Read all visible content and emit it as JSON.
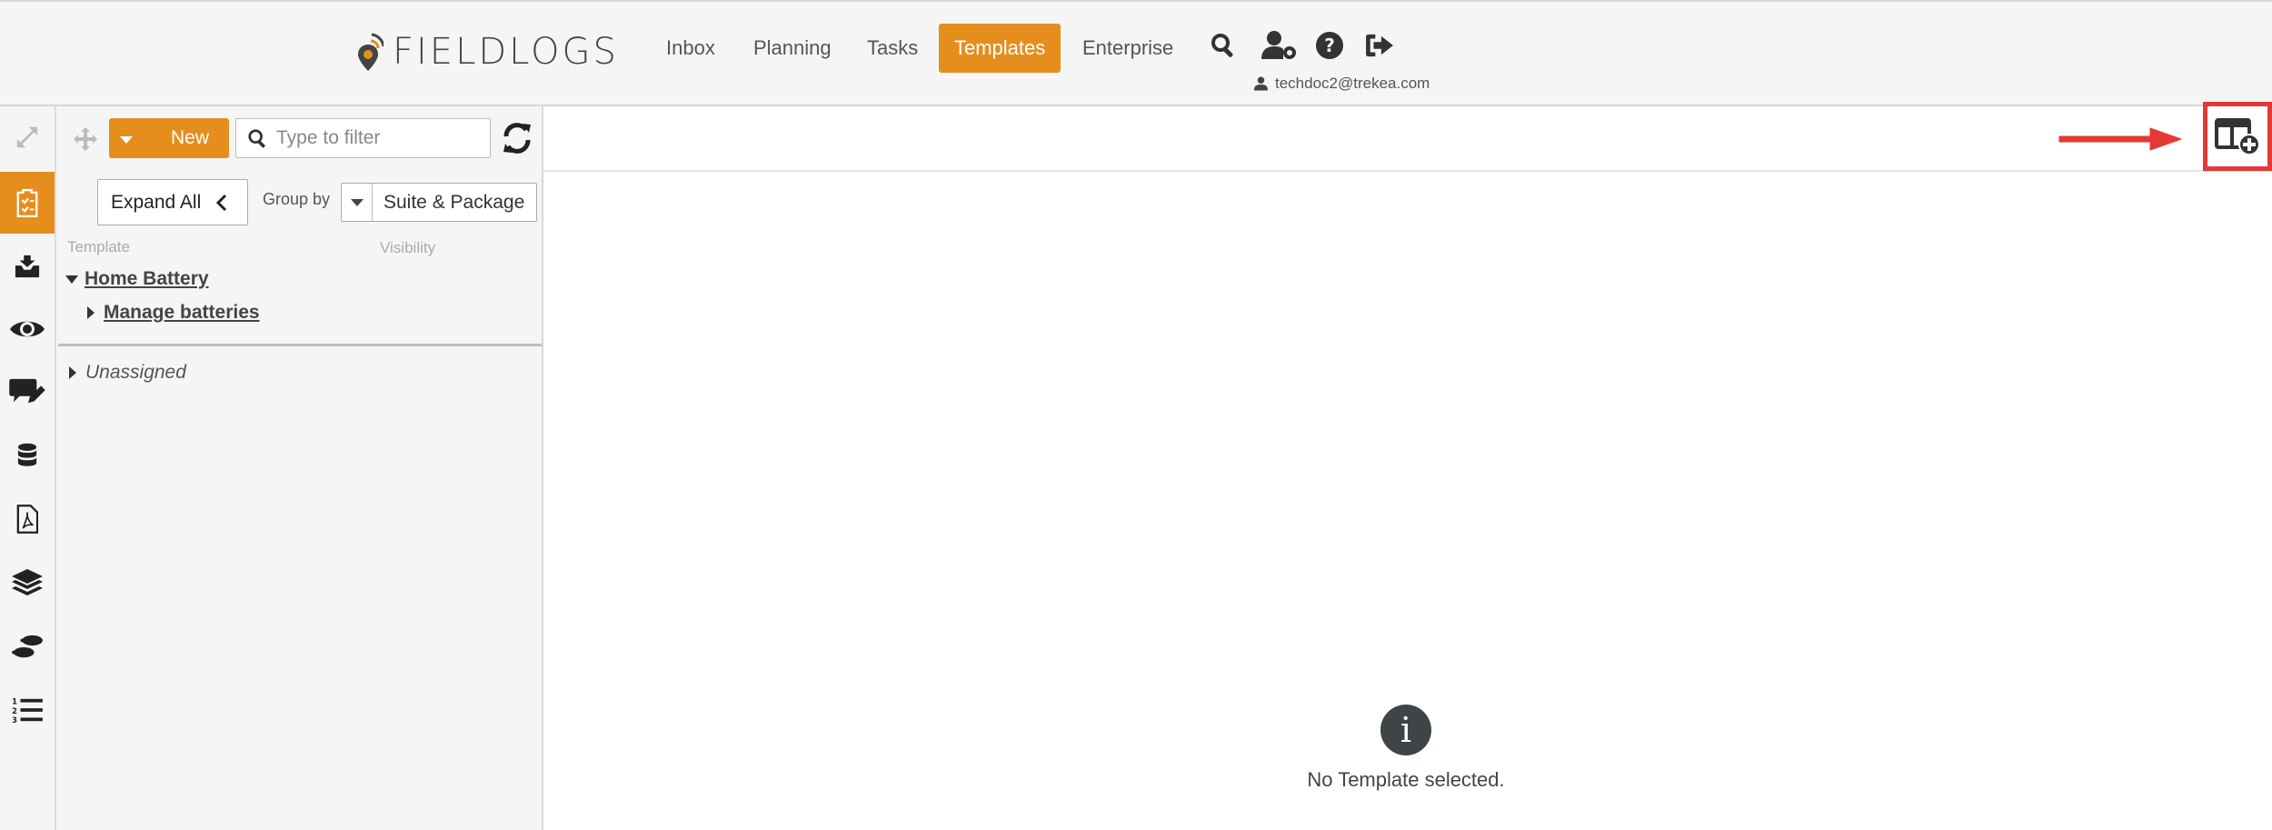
{
  "header": {
    "logo_text": "FIELDLOGS",
    "nav": [
      {
        "label": "Inbox"
      },
      {
        "label": "Planning"
      },
      {
        "label": "Tasks"
      },
      {
        "label": "Templates",
        "active": true
      },
      {
        "label": "Enterprise"
      }
    ],
    "icons": [
      "search-icon",
      "user-settings-icon",
      "help-icon",
      "logout-icon"
    ],
    "user_email": "techdoc2@trekea.com"
  },
  "rail": {
    "items": [
      "expand-arrows-icon",
      "clipboard-check-icon",
      "inbox-tray-icon",
      "eye-icon",
      "comment-edit-icon",
      "database-icon",
      "pdf-file-icon",
      "layers-icon",
      "footsteps-icon",
      "numbered-list-icon"
    ],
    "active": "clipboard-check-icon"
  },
  "panel": {
    "new_label": "New",
    "filter_placeholder": "Type to filter",
    "expand_all_label": "Expand All",
    "group_by_label": "Group by",
    "group_by_value": "Suite & Package",
    "columns": {
      "template": "Template",
      "visibility": "Visibility"
    },
    "tree": {
      "suite": "Home Battery",
      "package": "Manage batteries",
      "unassigned": "Unassigned"
    }
  },
  "main": {
    "empty_message": "No Template selected.",
    "info_glyph": "i"
  },
  "colors": {
    "accent": "#e58e1e",
    "highlight": "#e53935"
  }
}
